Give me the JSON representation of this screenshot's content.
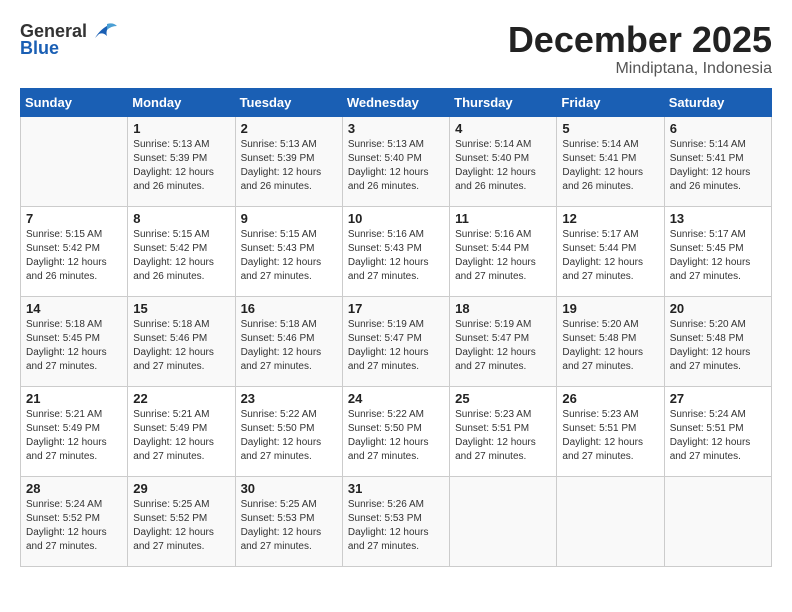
{
  "header": {
    "logo_general": "General",
    "logo_blue": "Blue",
    "month_title": "December 2025",
    "subtitle": "Mindiptana, Indonesia"
  },
  "days_of_week": [
    "Sunday",
    "Monday",
    "Tuesday",
    "Wednesday",
    "Thursday",
    "Friday",
    "Saturday"
  ],
  "weeks": [
    {
      "cells": [
        {
          "day": null,
          "date": ""
        },
        {
          "day": null,
          "date": "1",
          "sunrise": "Sunrise: 5:13 AM",
          "sunset": "Sunset: 5:39 PM",
          "daylight": "Daylight: 12 hours and 26 minutes."
        },
        {
          "day": null,
          "date": "2",
          "sunrise": "Sunrise: 5:13 AM",
          "sunset": "Sunset: 5:39 PM",
          "daylight": "Daylight: 12 hours and 26 minutes."
        },
        {
          "day": null,
          "date": "3",
          "sunrise": "Sunrise: 5:13 AM",
          "sunset": "Sunset: 5:40 PM",
          "daylight": "Daylight: 12 hours and 26 minutes."
        },
        {
          "day": null,
          "date": "4",
          "sunrise": "Sunrise: 5:14 AM",
          "sunset": "Sunset: 5:40 PM",
          "daylight": "Daylight: 12 hours and 26 minutes."
        },
        {
          "day": null,
          "date": "5",
          "sunrise": "Sunrise: 5:14 AM",
          "sunset": "Sunset: 5:41 PM",
          "daylight": "Daylight: 12 hours and 26 minutes."
        },
        {
          "day": null,
          "date": "6",
          "sunrise": "Sunrise: 5:14 AM",
          "sunset": "Sunset: 5:41 PM",
          "daylight": "Daylight: 12 hours and 26 minutes."
        }
      ]
    },
    {
      "cells": [
        {
          "day": null,
          "date": "7",
          "sunrise": "Sunrise: 5:15 AM",
          "sunset": "Sunset: 5:42 PM",
          "daylight": "Daylight: 12 hours and 26 minutes."
        },
        {
          "day": null,
          "date": "8",
          "sunrise": "Sunrise: 5:15 AM",
          "sunset": "Sunset: 5:42 PM",
          "daylight": "Daylight: 12 hours and 26 minutes."
        },
        {
          "day": null,
          "date": "9",
          "sunrise": "Sunrise: 5:15 AM",
          "sunset": "Sunset: 5:43 PM",
          "daylight": "Daylight: 12 hours and 27 minutes."
        },
        {
          "day": null,
          "date": "10",
          "sunrise": "Sunrise: 5:16 AM",
          "sunset": "Sunset: 5:43 PM",
          "daylight": "Daylight: 12 hours and 27 minutes."
        },
        {
          "day": null,
          "date": "11",
          "sunrise": "Sunrise: 5:16 AM",
          "sunset": "Sunset: 5:44 PM",
          "daylight": "Daylight: 12 hours and 27 minutes."
        },
        {
          "day": null,
          "date": "12",
          "sunrise": "Sunrise: 5:17 AM",
          "sunset": "Sunset: 5:44 PM",
          "daylight": "Daylight: 12 hours and 27 minutes."
        },
        {
          "day": null,
          "date": "13",
          "sunrise": "Sunrise: 5:17 AM",
          "sunset": "Sunset: 5:45 PM",
          "daylight": "Daylight: 12 hours and 27 minutes."
        }
      ]
    },
    {
      "cells": [
        {
          "day": null,
          "date": "14",
          "sunrise": "Sunrise: 5:18 AM",
          "sunset": "Sunset: 5:45 PM",
          "daylight": "Daylight: 12 hours and 27 minutes."
        },
        {
          "day": null,
          "date": "15",
          "sunrise": "Sunrise: 5:18 AM",
          "sunset": "Sunset: 5:46 PM",
          "daylight": "Daylight: 12 hours and 27 minutes."
        },
        {
          "day": null,
          "date": "16",
          "sunrise": "Sunrise: 5:18 AM",
          "sunset": "Sunset: 5:46 PM",
          "daylight": "Daylight: 12 hours and 27 minutes."
        },
        {
          "day": null,
          "date": "17",
          "sunrise": "Sunrise: 5:19 AM",
          "sunset": "Sunset: 5:47 PM",
          "daylight": "Daylight: 12 hours and 27 minutes."
        },
        {
          "day": null,
          "date": "18",
          "sunrise": "Sunrise: 5:19 AM",
          "sunset": "Sunset: 5:47 PM",
          "daylight": "Daylight: 12 hours and 27 minutes."
        },
        {
          "day": null,
          "date": "19",
          "sunrise": "Sunrise: 5:20 AM",
          "sunset": "Sunset: 5:48 PM",
          "daylight": "Daylight: 12 hours and 27 minutes."
        },
        {
          "day": null,
          "date": "20",
          "sunrise": "Sunrise: 5:20 AM",
          "sunset": "Sunset: 5:48 PM",
          "daylight": "Daylight: 12 hours and 27 minutes."
        }
      ]
    },
    {
      "cells": [
        {
          "day": null,
          "date": "21",
          "sunrise": "Sunrise: 5:21 AM",
          "sunset": "Sunset: 5:49 PM",
          "daylight": "Daylight: 12 hours and 27 minutes."
        },
        {
          "day": null,
          "date": "22",
          "sunrise": "Sunrise: 5:21 AM",
          "sunset": "Sunset: 5:49 PM",
          "daylight": "Daylight: 12 hours and 27 minutes."
        },
        {
          "day": null,
          "date": "23",
          "sunrise": "Sunrise: 5:22 AM",
          "sunset": "Sunset: 5:50 PM",
          "daylight": "Daylight: 12 hours and 27 minutes."
        },
        {
          "day": null,
          "date": "24",
          "sunrise": "Sunrise: 5:22 AM",
          "sunset": "Sunset: 5:50 PM",
          "daylight": "Daylight: 12 hours and 27 minutes."
        },
        {
          "day": null,
          "date": "25",
          "sunrise": "Sunrise: 5:23 AM",
          "sunset": "Sunset: 5:51 PM",
          "daylight": "Daylight: 12 hours and 27 minutes."
        },
        {
          "day": null,
          "date": "26",
          "sunrise": "Sunrise: 5:23 AM",
          "sunset": "Sunset: 5:51 PM",
          "daylight": "Daylight: 12 hours and 27 minutes."
        },
        {
          "day": null,
          "date": "27",
          "sunrise": "Sunrise: 5:24 AM",
          "sunset": "Sunset: 5:51 PM",
          "daylight": "Daylight: 12 hours and 27 minutes."
        }
      ]
    },
    {
      "cells": [
        {
          "day": null,
          "date": "28",
          "sunrise": "Sunrise: 5:24 AM",
          "sunset": "Sunset: 5:52 PM",
          "daylight": "Daylight: 12 hours and 27 minutes."
        },
        {
          "day": null,
          "date": "29",
          "sunrise": "Sunrise: 5:25 AM",
          "sunset": "Sunset: 5:52 PM",
          "daylight": "Daylight: 12 hours and 27 minutes."
        },
        {
          "day": null,
          "date": "30",
          "sunrise": "Sunrise: 5:25 AM",
          "sunset": "Sunset: 5:53 PM",
          "daylight": "Daylight: 12 hours and 27 minutes."
        },
        {
          "day": null,
          "date": "31",
          "sunrise": "Sunrise: 5:26 AM",
          "sunset": "Sunset: 5:53 PM",
          "daylight": "Daylight: 12 hours and 27 minutes."
        },
        {
          "day": null,
          "date": ""
        },
        {
          "day": null,
          "date": ""
        },
        {
          "day": null,
          "date": ""
        }
      ]
    }
  ]
}
